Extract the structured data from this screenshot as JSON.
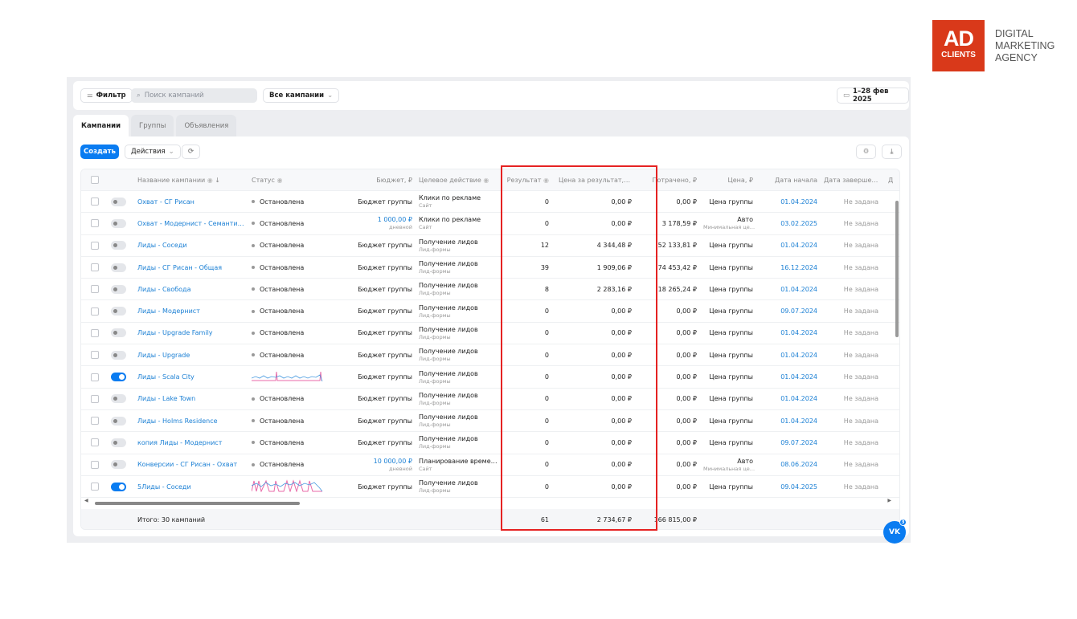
{
  "logo": {
    "line1": "AD",
    "line2": "CLIENTS",
    "agency": [
      "DIGITAL",
      "MARKETING",
      "AGENCY"
    ]
  },
  "toolbar": {
    "filter_label": "Фильтр",
    "search_placeholder": "Поиск кампаний",
    "campaigns_select": "Все кампании",
    "date_range": "1–28 фев 2025"
  },
  "tabs": [
    {
      "label": "Кампании",
      "active": true
    },
    {
      "label": "Группы"
    },
    {
      "label": "Объявления"
    }
  ],
  "actions": {
    "create_label": "Создать",
    "actions_label": "Действия"
  },
  "columns": [
    "Название кампании",
    "Статус",
    "Бюджет, ₽",
    "Целевое действие",
    "Результат",
    "Цена за результат, ₽",
    "Потрачено, ₽",
    "Цена, ₽",
    "Дата начала",
    "Дата завершения",
    "Д"
  ],
  "rows": [
    {
      "name": "Охват - СГ Рисан",
      "on": false,
      "status": "Остановлена",
      "budget": "Бюджет группы",
      "target": "Клики по рекламе",
      "target_sub": "Сайт",
      "result": "0",
      "cpr": "0,00 ₽",
      "spent": "0,00 ₽",
      "price": "Цена группы",
      "start": "01.04.2024",
      "end": "Не задана"
    },
    {
      "name": "Охват - Модернист - Семантика",
      "on": false,
      "status": "Остановлена",
      "budget": "1 000,00 ₽",
      "budget_sub": "дневной",
      "target": "Клики по рекламе",
      "target_sub": "Сайт",
      "result": "0",
      "cpr": "0,00 ₽",
      "spent": "3 178,59 ₽",
      "price": "Авто",
      "price_sub": "Минимальная це...",
      "start": "03.02.2025",
      "end": "Не задана"
    },
    {
      "name": "Лиды - Соседи",
      "on": false,
      "status": "Остановлена",
      "budget": "Бюджет группы",
      "target": "Получение лидов",
      "target_sub": "Лид-формы",
      "result": "12",
      "cpr": "4 344,48 ₽",
      "spent": "52 133,81 ₽",
      "price": "Цена группы",
      "start": "01.04.2024",
      "end": "Не задана"
    },
    {
      "name": "Лиды - СГ Рисан - Общая",
      "on": false,
      "status": "Остановлена",
      "budget": "Бюджет группы",
      "target": "Получение лидов",
      "target_sub": "Лид-формы",
      "result": "39",
      "cpr": "1 909,06 ₽",
      "spent": "74 453,42 ₽",
      "price": "Цена группы",
      "start": "16.12.2024",
      "end": "Не задана"
    },
    {
      "name": "Лиды - Свобода",
      "on": false,
      "status": "Остановлена",
      "budget": "Бюджет группы",
      "target": "Получение лидов",
      "target_sub": "Лид-формы",
      "result": "8",
      "cpr": "2 283,16 ₽",
      "spent": "18 265,24 ₽",
      "price": "Цена группы",
      "start": "01.04.2024",
      "end": "Не задана"
    },
    {
      "name": "Лиды - Модернист",
      "on": false,
      "status": "Остановлена",
      "budget": "Бюджет группы",
      "target": "Получение лидов",
      "target_sub": "Лид-формы",
      "result": "0",
      "cpr": "0,00 ₽",
      "spent": "0,00 ₽",
      "price": "Цена группы",
      "start": "09.07.2024",
      "end": "Не задана"
    },
    {
      "name": "Лиды - Upgrade Family",
      "on": false,
      "status": "Остановлена",
      "budget": "Бюджет группы",
      "target": "Получение лидов",
      "target_sub": "Лид-формы",
      "result": "0",
      "cpr": "0,00 ₽",
      "spent": "0,00 ₽",
      "price": "Цена группы",
      "start": "01.04.2024",
      "end": "Не задана"
    },
    {
      "name": "Лиды - Upgrade",
      "on": false,
      "status": "Остановлена",
      "budget": "Бюджет группы",
      "target": "Получение лидов",
      "target_sub": "Лид-формы",
      "result": "0",
      "cpr": "0,00 ₽",
      "spent": "0,00 ₽",
      "price": "Цена группы",
      "start": "01.04.2024",
      "end": "Не задана"
    },
    {
      "name": "Лиды - Scala City",
      "on": true,
      "status": "",
      "spark": 1,
      "budget": "Бюджет группы",
      "target": "Получение лидов",
      "target_sub": "Лид-формы",
      "result": "0",
      "cpr": "0,00 ₽",
      "spent": "0,00 ₽",
      "price": "Цена группы",
      "start": "01.04.2024",
      "end": "Не задана"
    },
    {
      "name": "Лиды - Lake Town",
      "on": false,
      "status": "Остановлена",
      "budget": "Бюджет группы",
      "target": "Получение лидов",
      "target_sub": "Лид-формы",
      "result": "0",
      "cpr": "0,00 ₽",
      "spent": "0,00 ₽",
      "price": "Цена группы",
      "start": "01.04.2024",
      "end": "Не задана"
    },
    {
      "name": "Лиды - Holms Residence",
      "on": false,
      "status": "Остановлена",
      "budget": "Бюджет группы",
      "target": "Получение лидов",
      "target_sub": "Лид-формы",
      "result": "0",
      "cpr": "0,00 ₽",
      "spent": "0,00 ₽",
      "price": "Цена группы",
      "start": "01.04.2024",
      "end": "Не задана"
    },
    {
      "name": "копия Лиды - Модернист",
      "on": false,
      "status": "Остановлена",
      "budget": "Бюджет группы",
      "target": "Получение лидов",
      "target_sub": "Лид-формы",
      "result": "0",
      "cpr": "0,00 ₽",
      "spent": "0,00 ₽",
      "price": "Цена группы",
      "start": "09.07.2024",
      "end": "Не задана"
    },
    {
      "name": "Конверсии - СГ Рисан - Охват",
      "on": false,
      "status": "Остановлена",
      "budget": "10 000,00 ₽",
      "budget_sub": "дневной",
      "target": "Планирование времени п...",
      "target_sub": "Сайт",
      "result": "0",
      "cpr": "0,00 ₽",
      "spent": "0,00 ₽",
      "price": "Авто",
      "price_sub": "Минимальная це...",
      "start": "08.06.2024",
      "end": "Не задана"
    },
    {
      "name": "5Лиды - Соседи",
      "on": true,
      "status": "",
      "spark": 2,
      "budget": "Бюджет группы",
      "target": "Получение лидов",
      "target_sub": "Лид-формы",
      "result": "0",
      "cpr": "0,00 ₽",
      "spent": "0,00 ₽",
      "price": "Цена группы",
      "start": "09.04.2025",
      "end": "Не задана"
    }
  ],
  "footer": {
    "total_label": "Итого: 30 кампаний",
    "result": "61",
    "cpr": "2 734,67 ₽",
    "spent": "166 815,00 ₽"
  },
  "vk": {
    "label": "VK",
    "badge": "3"
  }
}
